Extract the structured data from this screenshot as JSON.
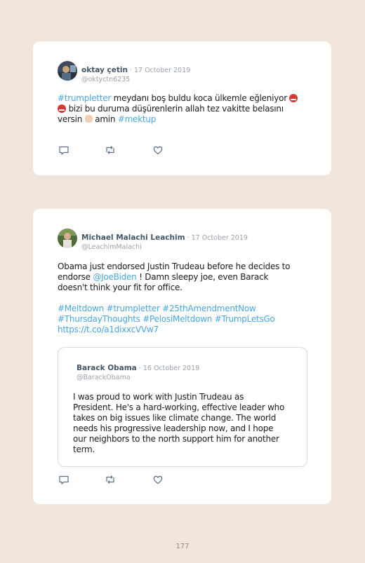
{
  "tweets": [
    {
      "author": "oktay çetin",
      "date": "17 October 2019",
      "handle": "@oktyctn6235",
      "avatar_icon": "profile-photo",
      "text": {
        "hashtag1": "#trumpletter",
        "part1": " meydanı boş buldu koca ülkemle eğleniyor ",
        "line2": " bizi bu duruma düşürenlerin allah tez vakitte belasını",
        "line3a": "versin ",
        "line3b": " amin ",
        "hashtag2": "#mektup",
        "emoji_angry": "angry-face-emoji",
        "emoji_hands": "folded-hands-emoji"
      }
    },
    {
      "author": "Michael Malachi Leachim",
      "date": "17 October 2019",
      "handle": "@LeachimMalachi",
      "avatar_icon": "profile-photo",
      "text": {
        "line1": "Obama just endorsed Justin Trudeau before he decides to",
        "line2a": "endorse ",
        "mention": "@JoeBiden",
        "line2b": " ! Damn sleepy joe, even Barack",
        "line3": "doesn't think your fit for office.",
        "tags1": "#Meltdown #trumpletter #25thAmendmentNow",
        "tags2": "#ThursdayThoughts #PelosiMeltdown #TrumpLetsGo",
        "url": "https://t.co/a1dixxcVVw7"
      },
      "quote": {
        "author": "Barack Obama",
        "date": "16 October 2019",
        "handle": "@BarackObama",
        "lines": [
          "I was proud to work with Justin Trudeau as",
          "President. He's a hard-working, effective leader who",
          "takes on big issues like climate change. The world",
          "needs his progressive leadership now, and I hope",
          "our neighbors to the north support him for another",
          "term."
        ]
      }
    }
  ],
  "actions": {
    "reply_icon": "reply-icon",
    "retweet_icon": "retweet-icon",
    "like_icon": "like-icon"
  },
  "page_number": "177",
  "colors": {
    "background": "#f2e6dc",
    "card": "#ffffff",
    "link": "#4aa6e2",
    "name": "#465766",
    "muted": "#9aa3ab"
  }
}
